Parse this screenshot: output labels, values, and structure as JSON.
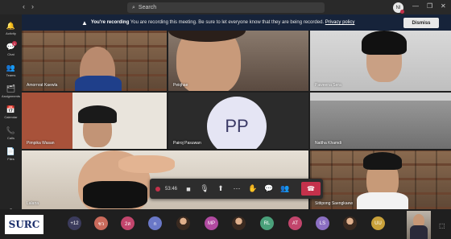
{
  "search": {
    "placeholder": "Search"
  },
  "account": {
    "initials": "NI"
  },
  "rail": [
    {
      "label": "Activity",
      "icon": "bell-icon",
      "glyph": "🔔"
    },
    {
      "label": "Chat",
      "icon": "chat-icon",
      "glyph": "💬",
      "badge": "1"
    },
    {
      "label": "Teams",
      "icon": "teams-icon",
      "glyph": "👥"
    },
    {
      "label": "Assignments",
      "icon": "assignments-icon",
      "glyph": "🗂"
    },
    {
      "label": "Calendar",
      "icon": "calendar-icon",
      "glyph": "📅"
    },
    {
      "label": "Calls",
      "icon": "phone-icon",
      "glyph": "📞"
    },
    {
      "label": "Files",
      "icon": "file-icon",
      "glyph": "📄"
    },
    {
      "label": "Help",
      "icon": "help-icon",
      "glyph": "?"
    }
  ],
  "banner": {
    "title": "You're recording",
    "message": "You are recording this meeting. Be sure to let everyone know that they are being recorded.",
    "link": "Privacy policy",
    "dismiss": "Dismiss"
  },
  "participants": [
    {
      "name": "Amornrat Kaewla"
    },
    {
      "name": "Peiqhae"
    },
    {
      "name": "Paweena Sera"
    },
    {
      "name": "Pimpika Wasan"
    },
    {
      "name": "Pairoj Pasuwan",
      "initials": "PP"
    },
    {
      "name": "Nattha Khamdi"
    },
    {
      "name": "Lalana"
    },
    {
      "name": "Sittipong Saengkaew"
    }
  ],
  "controls": {
    "timer": "53:46"
  },
  "logo": {
    "text": "SURC"
  },
  "overflow": {
    "count": "+12"
  },
  "strip": [
    {
      "text": "ชว",
      "color": "#c96a5b"
    },
    {
      "text": "2ส",
      "color": "#c2456c"
    },
    {
      "text": "ก",
      "color": "#6a78c7"
    },
    {
      "text": "",
      "photo": true
    },
    {
      "text": "MP",
      "color": "#b04aa0"
    },
    {
      "text": "",
      "photo": true
    },
    {
      "text": "RL",
      "color": "#4aa07a"
    },
    {
      "text": "AT",
      "color": "#c2456c"
    },
    {
      "text": "LS",
      "color": "#8b6fc2"
    },
    {
      "text": "",
      "photo": true
    },
    {
      "text": "UU",
      "color": "#c9a13a"
    }
  ]
}
